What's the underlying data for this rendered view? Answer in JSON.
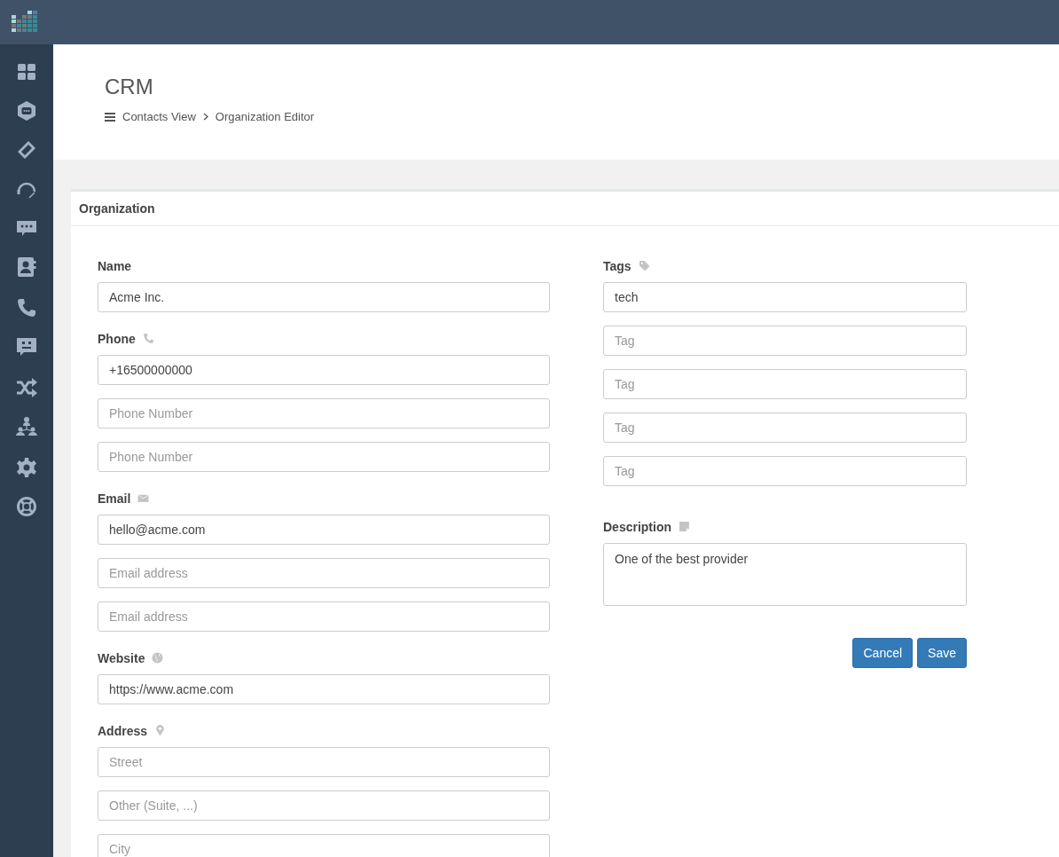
{
  "sidebar": {
    "groups": [
      [
        {
          "kind": "dashboard"
        },
        {
          "kind": "hexagon-chat"
        },
        {
          "kind": "ticket"
        },
        {
          "kind": "headset"
        },
        {
          "kind": "chat"
        },
        {
          "kind": "contacts"
        }
      ],
      [
        {
          "kind": "phone"
        },
        {
          "kind": "message"
        }
      ],
      [
        {
          "kind": "shuffle"
        },
        {
          "kind": "org"
        }
      ],
      [
        {
          "kind": "gear"
        },
        {
          "kind": "lifebuoy"
        }
      ]
    ]
  },
  "header": {
    "title": "CRM",
    "breadcrumb": [
      "Contacts View",
      "Organization Editor"
    ]
  },
  "card": {
    "title": "Organization",
    "left": [
      {
        "label": "Name",
        "kind": "none",
        "fields": [
          {
            "value": "Acme Inc."
          }
        ]
      },
      {
        "label": "Phone",
        "kind": "phone",
        "fields": [
          {
            "value": "+16500000000"
          },
          {
            "placeholder": "Phone Number"
          },
          {
            "placeholder": "Phone Number"
          }
        ]
      },
      {
        "label": "Email",
        "kind": "email",
        "fields": [
          {
            "value": "hello@acme.com"
          },
          {
            "placeholder": "Email address"
          },
          {
            "placeholder": "Email address"
          }
        ]
      },
      {
        "label": "Website",
        "kind": "website",
        "fields": [
          {
            "value": "https://www.acme.com"
          }
        ]
      },
      {
        "label": "Address",
        "kind": "address",
        "fields": [
          {
            "placeholder": "Street"
          },
          {
            "placeholder": "Other (Suite, ...)"
          },
          {
            "placeholder": "City"
          }
        ]
      }
    ],
    "right": [
      {
        "label": "Tags",
        "kind": "tags",
        "fields": [
          {
            "value": "tech"
          },
          {
            "placeholder": "Tag"
          },
          {
            "placeholder": "Tag"
          },
          {
            "placeholder": "Tag"
          },
          {
            "placeholder": "Tag"
          }
        ]
      },
      {
        "label": "Description",
        "kind": "description",
        "fields": [
          {
            "value": "One of the best provider"
          }
        ]
      }
    ],
    "buttons": [
      "Cancel",
      "Save"
    ]
  }
}
